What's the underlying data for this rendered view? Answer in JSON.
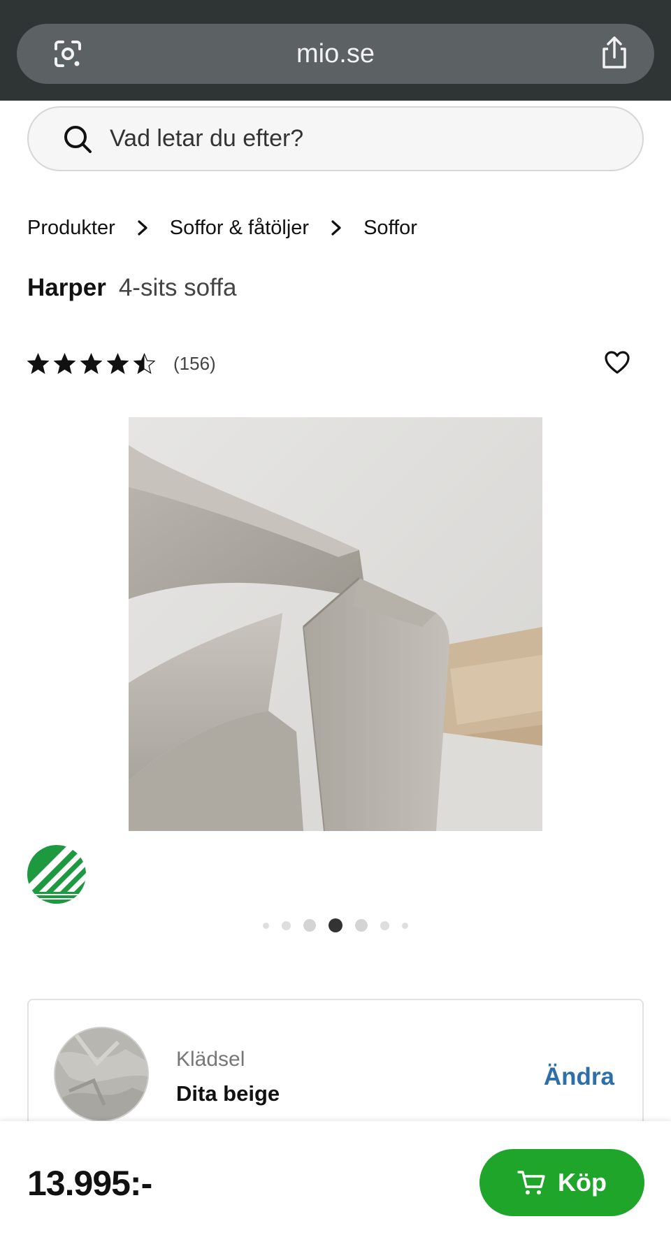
{
  "browser": {
    "url": "mio.se"
  },
  "search": {
    "placeholder": "Vad letar du efter?"
  },
  "breadcrumb": [
    "Produkter",
    "Soffor & fåtöljer",
    "Soffor"
  ],
  "product": {
    "name": "Harper",
    "type": "4-sits soffa",
    "rating_stars": 4.5,
    "rating_max": 5,
    "review_count": "(156)"
  },
  "gallery": {
    "dot_count": 7,
    "active_dot": 4
  },
  "upholstery": {
    "label": "Klädsel",
    "value": "Dita beige",
    "change_label": "Ändra"
  },
  "checkout": {
    "price": "13.995:-",
    "buy_label": "Köp"
  },
  "colors": {
    "buy_green": "#1fa52a",
    "link_blue": "#2d6fa8",
    "eco_green": "#1d9a3f",
    "browser_chrome": "#2f3435"
  }
}
